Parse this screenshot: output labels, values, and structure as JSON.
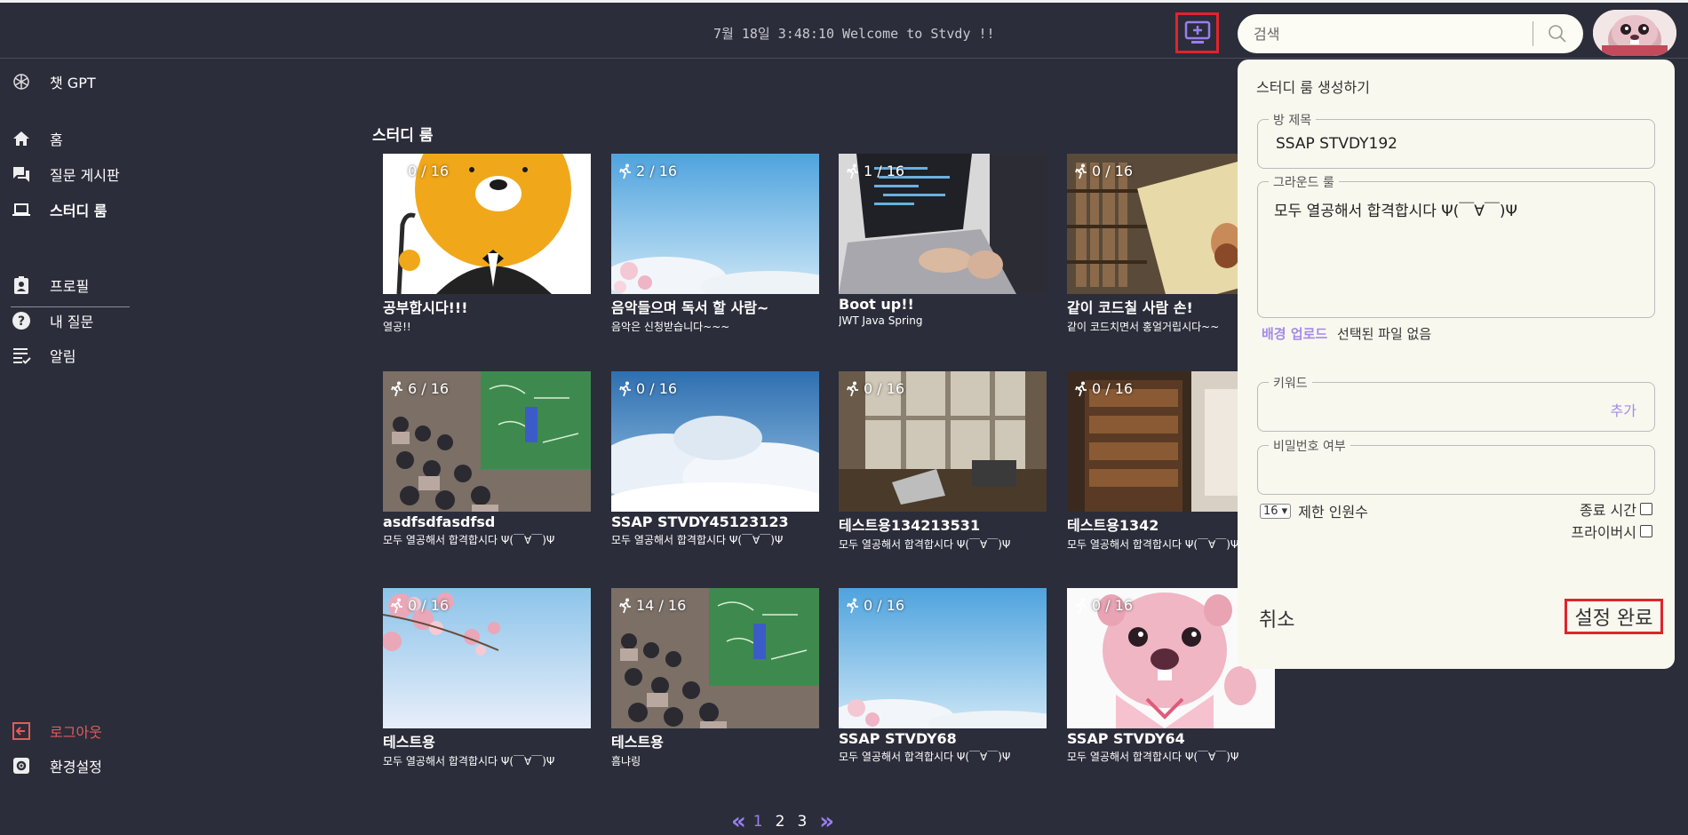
{
  "header": {
    "clock_text": "7월 18일 3:48:10 Welcome to Stvdy !!",
    "search_placeholder": "검색"
  },
  "sidebar": {
    "chatgpt": "챗 GPT",
    "home": "홈",
    "qna_board": "질문 게시판",
    "study_room": "스터디 룸",
    "profile": "프로필",
    "my_questions": "내 질문",
    "notifications": "알림",
    "logout": "로그아웃",
    "settings": "환경설정"
  },
  "main": {
    "section_title": "스터디 룸",
    "rooms": [
      {
        "count": "0 / 16",
        "title": "공부합시다!!!",
        "desc": "열공!!"
      },
      {
        "count": "2 / 16",
        "title": "음악들으며 독서 할 사람~",
        "desc": "음악은 신청받습니다~~~"
      },
      {
        "count": "1 / 16",
        "title": "Boot up!!",
        "desc": "JWT Java Spring"
      },
      {
        "count": "0 / 16",
        "title": "같이 코드칠 사람 손!",
        "desc": "같이 코드치면서 홍얼거립시다~~"
      },
      {
        "count": "6 / 16",
        "title": "asdfsdfasdfsd",
        "desc": "모두 열공해서 합격합시다 Ψ(￣∀￣)Ψ"
      },
      {
        "count": "0 / 16",
        "title": "SSAP STVDY45123123",
        "desc": "모두 열공해서 합격합시다 Ψ(￣∀￣)Ψ"
      },
      {
        "count": "0 / 16",
        "title": "테스트용134213531",
        "desc": "모두 열공해서 합격합시다 Ψ(￣∀￣)Ψ"
      },
      {
        "count": "0 / 16",
        "title": "테스트용1342",
        "desc": "모두 열공해서 합격합시다 Ψ(￣∀￣)Ψ"
      },
      {
        "count": "0 / 16",
        "title": "테스트용",
        "desc": "모두 열공해서 합격합시다 Ψ(￣∀￣)Ψ"
      },
      {
        "count": "14 / 16",
        "title": "테스트용",
        "desc": "흠냐링"
      },
      {
        "count": "0 / 16",
        "title": "SSAP STVDY68",
        "desc": "모두 열공해서 합격합시다 Ψ(￣∀￣)Ψ"
      },
      {
        "count": "0 / 16",
        "title": "SSAP STVDY64",
        "desc": "모두 열공해서 합격합시다 Ψ(￣∀￣)Ψ"
      }
    ],
    "pagination": {
      "prev": "«",
      "pages": [
        "1",
        "2",
        "3"
      ],
      "current": "1",
      "next": "»"
    }
  },
  "create_panel": {
    "title": "스터디 룸 생성하기",
    "room_name_label": "방 제목",
    "room_name_value": "SSAP STVDY192",
    "ground_rule_label": "그라운드 룰",
    "ground_rule_value": "모두 열공해서 합격합시다 Ψ(￣∀￣)Ψ",
    "upload_label": "배경 업로드",
    "no_file_text": "선택된 파일 없음",
    "keyword_label": "키워드",
    "add_label": "추가",
    "password_label": "비밀번호 여부",
    "max_people_value": "16",
    "max_people_label": "제한 인원수",
    "end_time_label": "종료 시간",
    "privacy_label": "프라이버시",
    "cancel_label": "취소",
    "confirm_label": "설정 완료"
  },
  "colors": {
    "background": "#2b2d3a",
    "accent": "#9a7ef0",
    "highlight": "#e0242c",
    "logout": "#e35b5b",
    "panel": "#f8f8ef"
  }
}
